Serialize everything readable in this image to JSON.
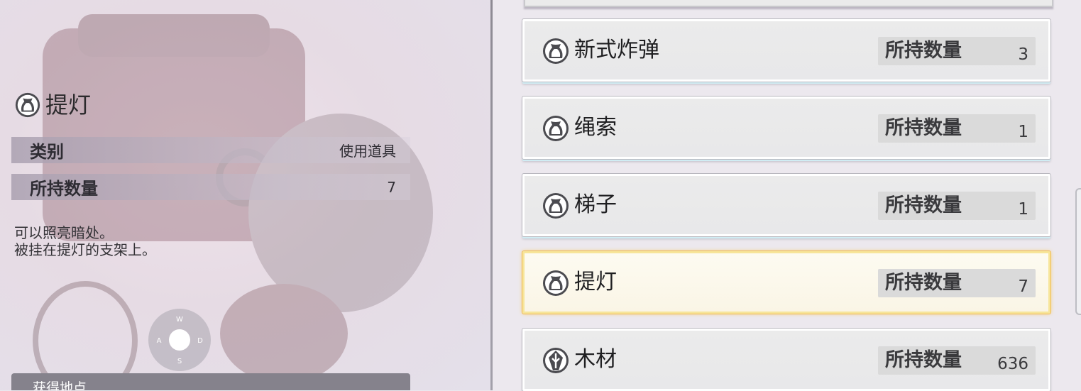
{
  "detail": {
    "title": "提灯",
    "icon": "sack-icon",
    "attributes": [
      {
        "key": "类别",
        "value": "使用道具"
      },
      {
        "key": "所持数量",
        "value": "7"
      }
    ],
    "description": "可以照亮暗处。\n被挂在提灯的支架上。",
    "compass": {
      "n": "W",
      "w": "A",
      "e": "D",
      "s": "S"
    },
    "bottom_label": "获得地点"
  },
  "list": {
    "qty_label": "所持数量",
    "items": [
      {
        "name": "新式炸弹",
        "qty": "3",
        "icon": "sack-icon",
        "selected": false
      },
      {
        "name": "绳索",
        "qty": "1",
        "icon": "sack-icon",
        "selected": false
      },
      {
        "name": "梯子",
        "qty": "1",
        "icon": "sack-icon",
        "selected": false
      },
      {
        "name": "提灯",
        "qty": "7",
        "icon": "sack-icon",
        "selected": true
      },
      {
        "name": "木材",
        "qty": "636",
        "icon": "material-icon",
        "selected": false
      }
    ]
  },
  "colors": {
    "selected_border": "#f0b957",
    "item_background": "#ebebeb",
    "qty_background": "#dadada"
  }
}
